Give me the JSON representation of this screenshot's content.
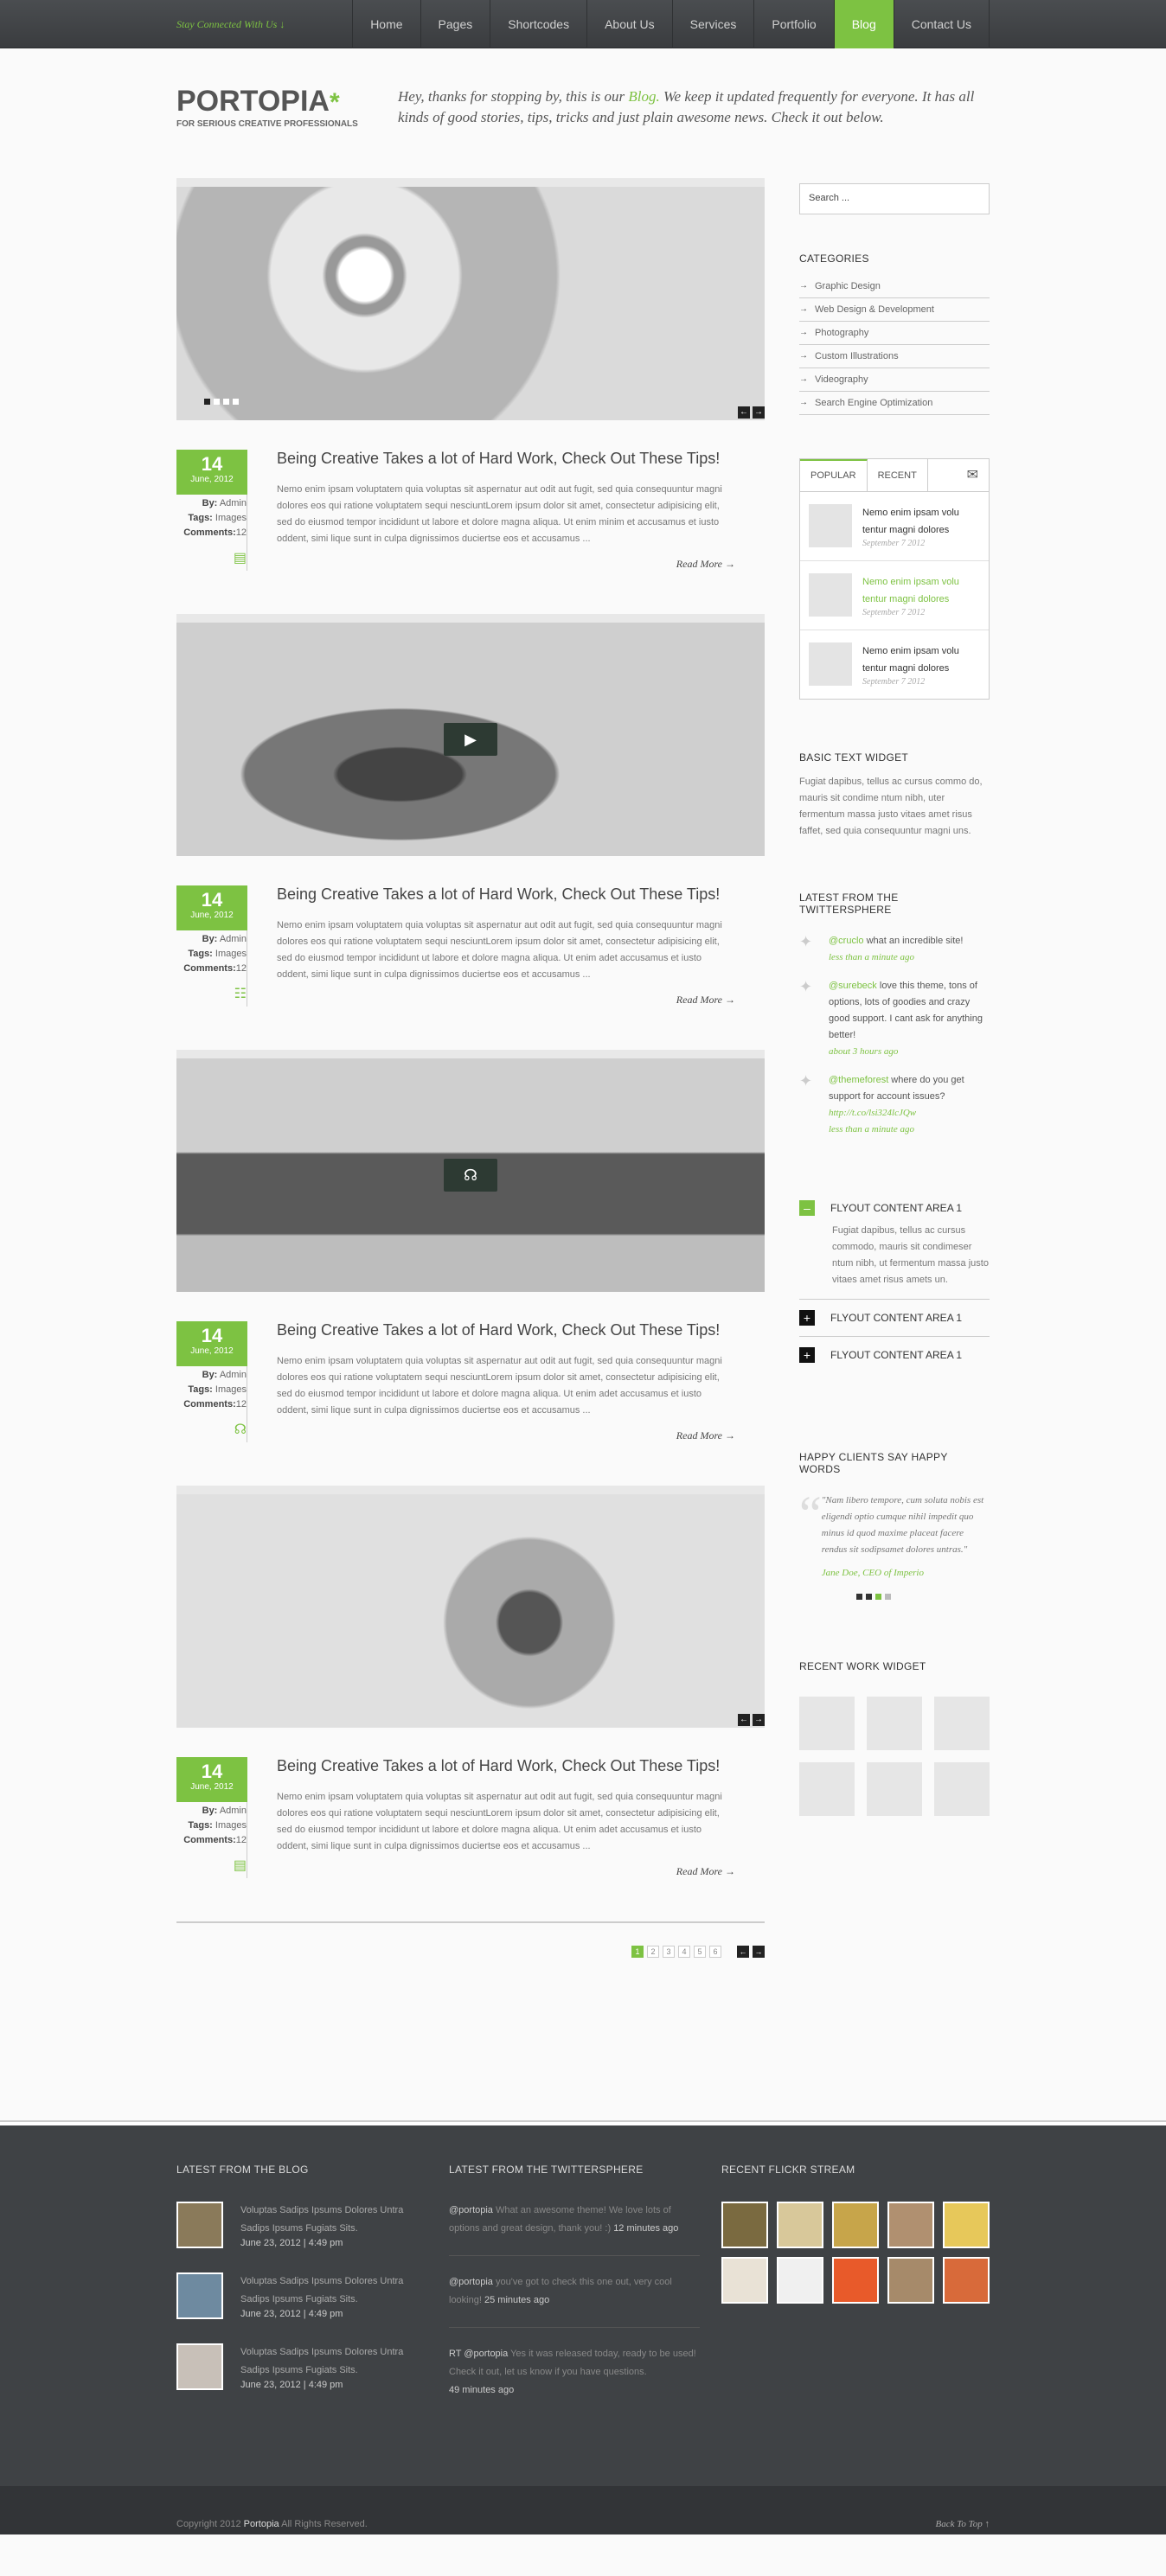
{
  "topbar": {
    "tagline": "Stay Connected With Us ↓",
    "nav": [
      "Home",
      "Pages",
      "Shortcodes",
      "About Us",
      "Services",
      "Portfolio",
      "Blog",
      "Contact Us"
    ],
    "active_index": 6
  },
  "header": {
    "logo": "PORTOPIA",
    "logo_mark": "*",
    "logo_sub": "FOR SERIOUS CREATIVE PROFESSIONALS",
    "intro_before": "Hey, thanks for stopping by, this is our ",
    "intro_link": "Blog.",
    "intro_after": " We keep it updated frequently for everyone. It has all kinds of good stories, tips, tricks and just plain awesome news. Check it out below."
  },
  "posts": [
    {
      "day": "14",
      "month": "June, 2012",
      "by_label": "By:",
      "by": "Admin",
      "tags_label": "Tags:",
      "tags": "Images",
      "comments_label": "Comments:",
      "comments": "12",
      "type_icon": "image-icon",
      "title": "Being Creative Takes a lot of Hard Work,  Check Out These Tips!",
      "excerpt": "Nemo enim ipsam voluptatem quia voluptas sit aspernatur aut odit aut fugit, sed quia consequuntur magni dolores eos qui ratione voluptatem sequi nesciuntLorem ipsum dolor sit amet, consectetur adipisicing elit, sed do eiusmod tempor incididunt ut labore et dolore magna aliqua. Ut enim minim et accusamus et iusto oddent, simi lique sunt in culpa dignissimos duciertse eos et accusamus ...",
      "read_more": "Read More →"
    },
    {
      "day": "14",
      "month": "June, 2012",
      "by_label": "By:",
      "by": "Admin",
      "tags_label": "Tags:",
      "tags": "Images",
      "comments_label": "Comments:",
      "comments": "12",
      "type_icon": "video-icon",
      "title": "Being Creative Takes a lot of Hard Work,  Check Out These Tips!",
      "excerpt": "Nemo enim ipsam voluptatem quia voluptas sit aspernatur aut odit aut fugit, sed quia consequuntur magni dolores eos qui ratione voluptatem sequi nesciuntLorem ipsum dolor sit amet, consectetur adipisicing elit, sed do eiusmod tempor incididunt ut labore et dolore magna aliqua. Ut enim adet accusamus et iusto oddent, simi lique sunt in culpa dignissimos duciertse eos et accusamus ...",
      "read_more": "Read More →"
    },
    {
      "day": "14",
      "month": "June, 2012",
      "by_label": "By:",
      "by": "Admin",
      "tags_label": "Tags:",
      "tags": "Images",
      "comments_label": "Comments:",
      "comments": "12",
      "type_icon": "audio-icon",
      "title": "Being Creative Takes a lot of Hard Work,  Check Out These Tips!",
      "excerpt": "Nemo enim ipsam voluptatem quia voluptas sit aspernatur aut odit aut fugit, sed quia consequuntur magni dolores eos qui ratione voluptatem sequi nesciuntLorem ipsum dolor sit amet, consectetur adipisicing elit, sed do eiusmod tempor incididunt ut labore et dolore magna aliqua. Ut enim adet accusamus et iusto oddent, simi lique sunt in culpa dignissimos duciertse eos et accusamus ...",
      "read_more": "Read More →"
    },
    {
      "day": "14",
      "month": "June, 2012",
      "by_label": "By:",
      "by": "Admin",
      "tags_label": "Tags:",
      "tags": "Images",
      "comments_label": "Comments:",
      "comments": "12",
      "type_icon": "image-icon",
      "title": "Being Creative Takes a lot of Hard Work,  Check Out These Tips!",
      "excerpt": "Nemo enim ipsam voluptatem quia voluptas sit aspernatur aut odit aut fugit, sed quia consequuntur magni dolores eos qui ratione voluptatem sequi nesciuntLorem ipsum dolor sit amet, consectetur adipisicing elit, sed do eiusmod tempor incididunt ut labore et dolore magna aliqua. Ut enim adet accusamus et iusto oddent, simi lique sunt in culpa dignissimos duciertse eos et accusamus ...",
      "read_more": "Read More →"
    }
  ],
  "pagination": {
    "pages": [
      "1",
      "2",
      "3",
      "4",
      "5",
      "6"
    ],
    "prev": "←",
    "next": "→"
  },
  "sidebar": {
    "search_placeholder": "Search ...",
    "categories_title": "CATEGORIES",
    "categories": [
      "Graphic Design",
      "Web Design & Development",
      "Photography",
      "Custom Illustrations",
      "Videography",
      "Search Engine Optimization"
    ],
    "tabs": {
      "popular": "POPULAR",
      "recent": "RECENT",
      "items": [
        {
          "title": "Nemo enim ipsam volu tentur magni dolores",
          "date": "September 7 2012"
        },
        {
          "title": "Nemo enim ipsam volu tentur magni dolores",
          "date": "September 7 2012"
        },
        {
          "title": "Nemo enim ipsam volu tentur magni dolores",
          "date": "September 7 2012"
        }
      ]
    },
    "basic_title": "BASIC TEXT WIDGET",
    "basic_text": "Fugiat dapibus, tellus ac cursus commo do, mauris sit condime ntum nibh, uter fermentum massa justo vitaes amet risus faffet, sed quia consequuntur magni uns.",
    "twitter_title": "LATEST FROM THE TWITTERSPHERE",
    "tweets": [
      {
        "user": "@cruclo",
        "text": " what an incredible site!",
        "when": "less than a minute ago"
      },
      {
        "user": "@surebeck",
        "text": " love this theme, tons of options, lots of goodies and crazy good support.  I cant ask for anything better!",
        "when": "about 3 hours ago"
      },
      {
        "user": "@themeforest",
        "text": " where do you get support for account issues? ",
        "link": "http://t.co/lsi324lcJQw",
        "when": "less than a minute ago"
      }
    ],
    "flyouts": [
      {
        "title": "FLYOUT CONTENT AREA 1",
        "body": "Fugiat dapibus, tellus ac cursus commodo, mauris sit condimeser ntum nibh, ut fermentum massa justo vitaes amet risus amets un."
      },
      {
        "title": "FLYOUT CONTENT AREA 1"
      },
      {
        "title": "FLYOUT CONTENT AREA 1"
      }
    ],
    "testimonial_title": "HAPPY CLIENTS SAY HAPPY WORDS",
    "testimonial": "\"Nam libero tempore, cum soluta nobis est eligendi optio cumque nihil impedit quo minus id quod maxime placeat facere rendus sit sodipsamet dolores untras.\"",
    "testimonial_by": "Jane Doe, CEO of Imperio",
    "works_title": "RECENT WORK WIDGET"
  },
  "footer": {
    "blog_title": "LATEST FROM THE BLOG",
    "blog": [
      {
        "text": "Voluptas Sadips Ipsums Dolores Untra Sadips Ipsums Fugiats Sits.",
        "date": "June 23, 2012   |   4:49 pm"
      },
      {
        "text": "Voluptas Sadips Ipsums Dolores Untra Sadips Ipsums Fugiats Sits.",
        "date": "June 23, 2012   |   4:49 pm"
      },
      {
        "text": "Voluptas Sadips Ipsums Dolores Untra Sadips Ipsums Fugiats Sits.",
        "date": "June 23, 2012   |   4:49 pm"
      }
    ],
    "twitter_title": "LATEST FROM THE TWITTERSPHERE",
    "tweets": [
      {
        "user": "@portopia",
        "text": " What an awesome theme!  We love lots of options and great design, thank you!  :) ",
        "when": "12 minutes ago"
      },
      {
        "user": "@portopia",
        "text": " you've got to check this one out, very cool looking! ",
        "when": "25 minutes ago"
      },
      {
        "user": "RT @portopia",
        "text": " Yes it was released today, ready to be used! Check it out, let us know if you have questions. ",
        "when": "49 minutes ago"
      }
    ],
    "flickr_title": "RECENT FLICKR STREAM",
    "copyright_before": "Copyright 2012 ",
    "copyright_brand": "Portopia",
    "copyright_after": "  All Rights Reserved.",
    "back_top": "Back To Top  ↑"
  },
  "colors": {
    "accent": "#7dc242",
    "topbar": "#3f4245",
    "footer": "#3f4245"
  }
}
